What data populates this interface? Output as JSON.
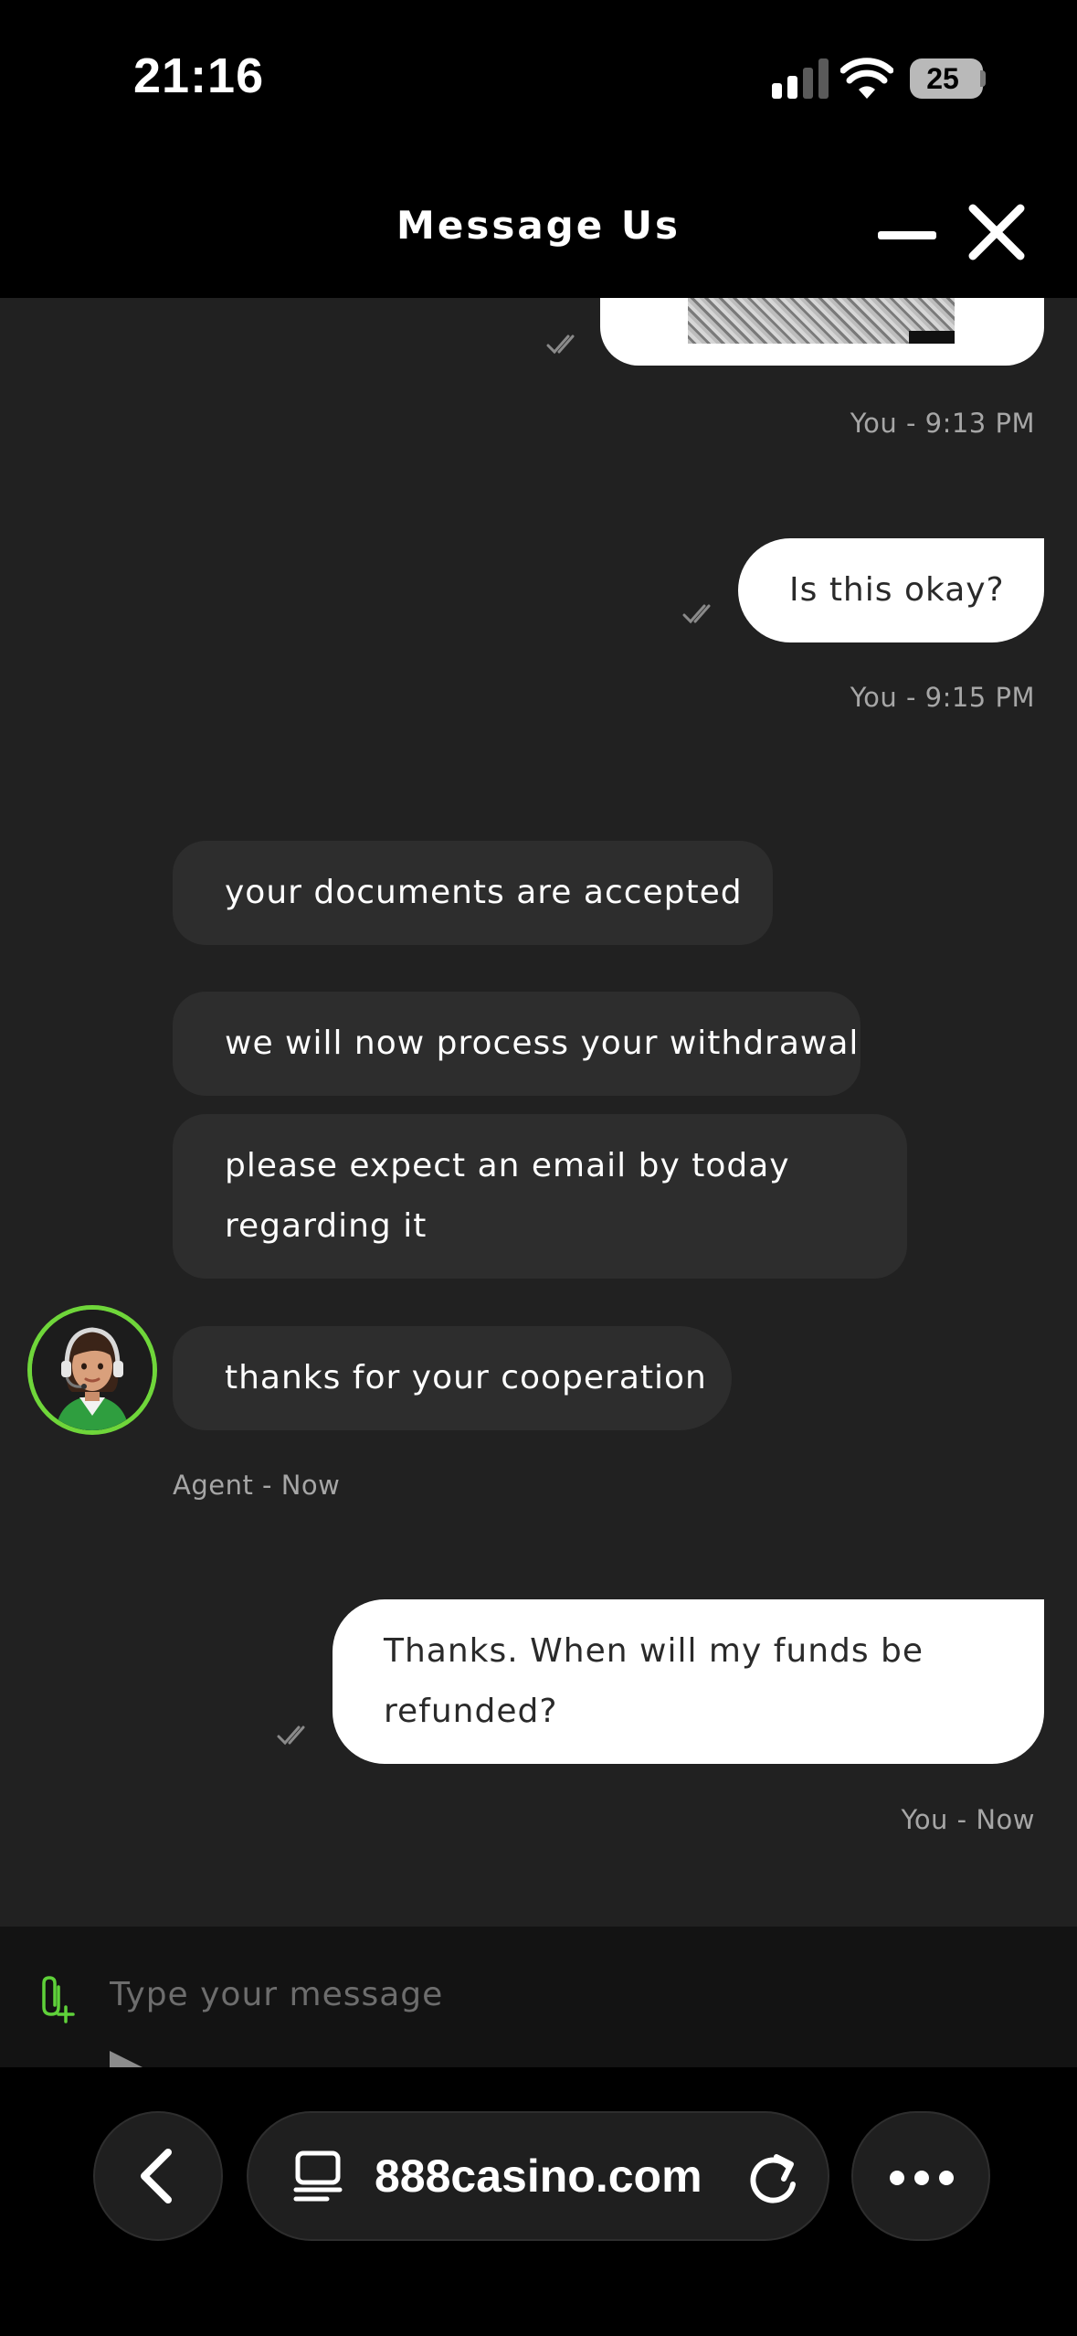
{
  "status_bar": {
    "time": "21:16",
    "battery_level": "25",
    "icons": [
      "signal-icon",
      "wifi-icon",
      "battery-icon"
    ]
  },
  "header": {
    "title": "Message Us",
    "minimize_icon": "minimize-icon",
    "close_icon": "close-icon"
  },
  "chat": {
    "messages": [
      {
        "sender": "user",
        "type": "image",
        "meta": "You - 9:13 PM"
      },
      {
        "sender": "user",
        "text": "Is this okay?",
        "meta": "You - 9:15 PM"
      },
      {
        "sender": "agent",
        "text": "your documents are accepted"
      },
      {
        "sender": "agent",
        "text": "we will now process your withdrawal"
      },
      {
        "sender": "agent",
        "lines": [
          "please expect an email by today",
          "regarding it"
        ]
      },
      {
        "sender": "agent",
        "text": "thanks for your cooperation",
        "meta": "Agent - Now"
      },
      {
        "sender": "user",
        "lines": [
          "Thanks. When will my funds be",
          "refunded?"
        ],
        "meta": "You - Now"
      }
    ]
  },
  "composer": {
    "placeholder": "Type your message",
    "attach_icon": "attachment-icon",
    "send_icon": "send-icon"
  },
  "browser": {
    "url": "888casino.com",
    "icons": [
      "back-icon",
      "page-icon",
      "reload-icon",
      "more-icon"
    ]
  },
  "colors": {
    "background": "#000000",
    "chat_background": "#212121",
    "agent_bubble": "#2d2d2d",
    "user_bubble": "#ffffff",
    "avatar_ring": "#6fd63a",
    "meta_text": "#a6a6a6"
  }
}
